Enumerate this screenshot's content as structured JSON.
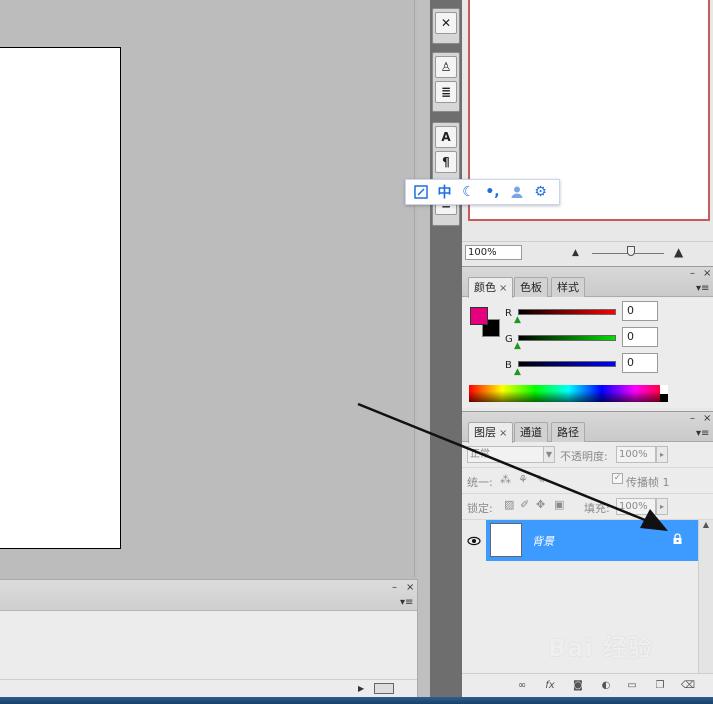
{
  "navigator": {
    "zoom_value": "100%"
  },
  "color_panel": {
    "tabs": [
      "颜色",
      "色板",
      "样式"
    ],
    "tab_close": "×",
    "fg_color": "#e4007f",
    "bg_color": "#000000",
    "channels": [
      {
        "label": "R",
        "value": "0"
      },
      {
        "label": "G",
        "value": "0"
      },
      {
        "label": "B",
        "value": "0"
      }
    ]
  },
  "layers_panel": {
    "tabs": [
      "图层",
      "通道",
      "路径"
    ],
    "tab_close": "×",
    "blend_mode": "正常",
    "opacity_label": "不透明度:",
    "opacity_value": "100%",
    "unify_label": "统一:",
    "propagate_label": "传播帧 1",
    "lock_label": "锁定:",
    "fill_label": "填充:",
    "fill_value": "100%",
    "layers": [
      {
        "name": "背景",
        "visible": true,
        "locked": true
      }
    ]
  },
  "panel_controls": {
    "minimize": "–",
    "close": "×"
  },
  "ime_toolbar": {
    "mode_label": "中"
  },
  "watermark": {
    "text": "Bai 经验"
  },
  "colors": {
    "selected_layer": "#3d9bff",
    "accent_red_frame": "#c75a5a",
    "ime_blue": "#1f6fe0"
  }
}
